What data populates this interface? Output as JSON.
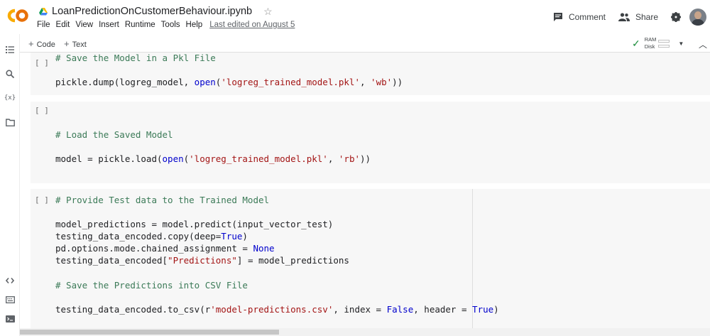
{
  "app": {
    "logo_text": "CO",
    "notebook_title": "LoanPredictionOnCustomerBehaviour.ipynb",
    "star": "☆"
  },
  "menu": [
    "File",
    "Edit",
    "View",
    "Insert",
    "Runtime",
    "Tools",
    "Help"
  ],
  "last_edited": "Last edited on August 5",
  "header_actions": {
    "comment_label": "Comment",
    "share_label": "Share"
  },
  "toolbar": {
    "add_code": "Code",
    "add_text": "Text",
    "ram_label": "RAM",
    "disk_label": "Disk"
  },
  "colors": {
    "code_comment": "#3b7a57",
    "code_string": "#a31515",
    "code_keyword": "#0000cc",
    "cell_background": "#f7f7f7",
    "connected_check": "#1e8e3e"
  },
  "cells": [
    {
      "run_indicator": "[ ]",
      "lines": [
        "# Save the Model in a Pkl File",
        "",
        "pickle.dump(logreg_model, open('logreg_trained_model.pkl', 'wb'))"
      ]
    },
    {
      "run_indicator": "[ ]",
      "lines": [
        "",
        "",
        "# Load the Saved Model",
        "",
        "model = pickle.load(open('logreg_trained_model.pkl', 'rb'))"
      ]
    },
    {
      "run_indicator": "[ ]",
      "lines": [
        "# Provide Test data to the Trained Model",
        "",
        "model_predictions = model.predict(input_vector_test)",
        "testing_data_encoded.copy(deep=True)",
        "pd.options.mode.chained_assignment = None",
        "testing_data_encoded[\"Predictions\"] = model_predictions",
        "",
        "# Save the Predictions into CSV File",
        "",
        "testing_data_encoded.to_csv(r'model-predictions.csv', index = False, header = True)"
      ]
    }
  ]
}
